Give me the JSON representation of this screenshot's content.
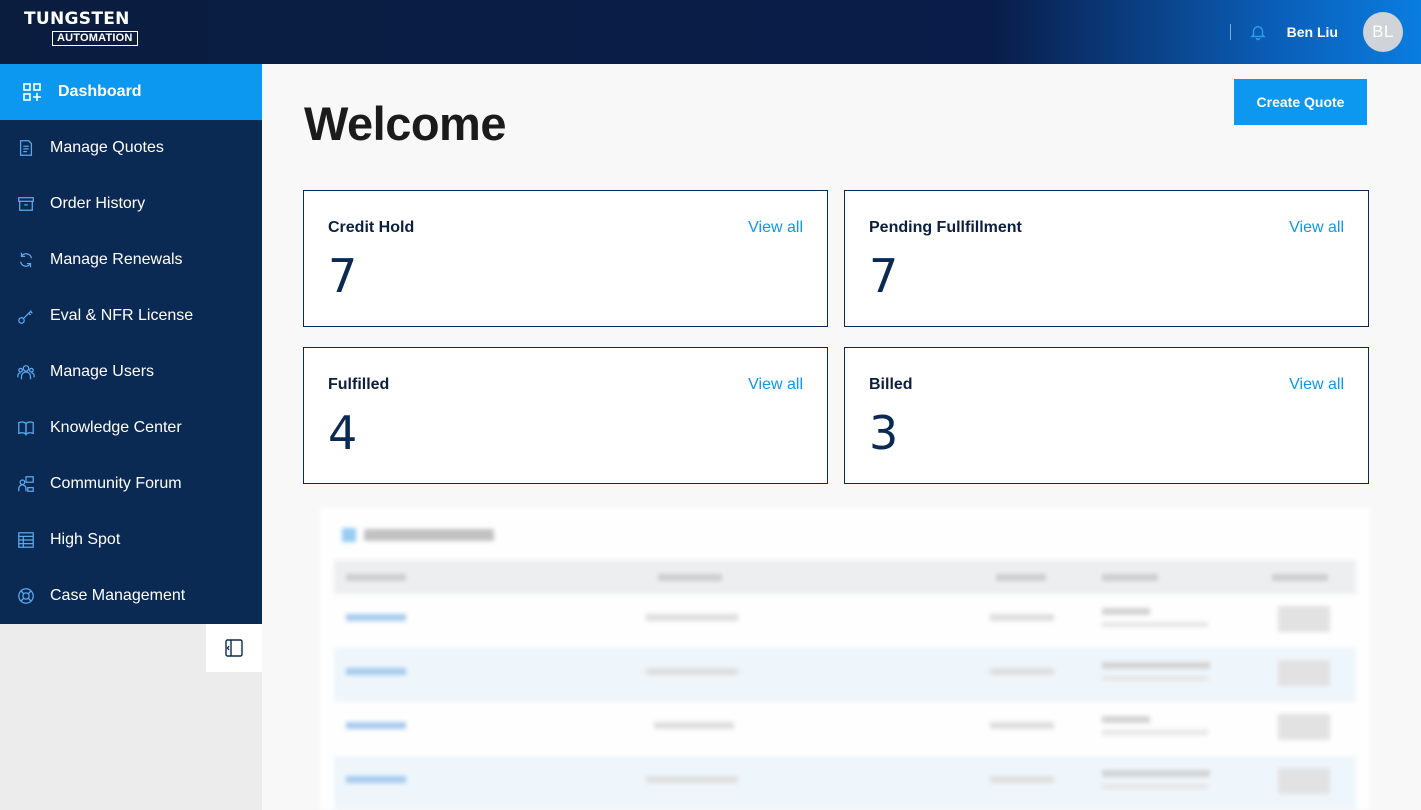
{
  "header": {
    "brand": {
      "line1": "TUNGSTEN",
      "line2": "AUTOMATION"
    },
    "user_name": "Ben Liu",
    "avatar_initials": "BL"
  },
  "sidebar": {
    "items": [
      {
        "label": "Dashboard",
        "icon": "dashboard-icon",
        "active": true
      },
      {
        "label": "Manage Quotes",
        "icon": "document-icon"
      },
      {
        "label": "Order History",
        "icon": "archive-icon"
      },
      {
        "label": "Manage Renewals",
        "icon": "refresh-icon"
      },
      {
        "label": "Eval & NFR License",
        "icon": "key-icon"
      },
      {
        "label": "Manage Users",
        "icon": "users-icon"
      },
      {
        "label": "Knowledge Center",
        "icon": "book-icon"
      },
      {
        "label": "Community Forum",
        "icon": "community-icon"
      },
      {
        "label": "High Spot",
        "icon": "spreadsheet-icon"
      },
      {
        "label": "Case Management",
        "icon": "lifebuoy-icon"
      }
    ]
  },
  "main": {
    "title": "Welcome",
    "create_quote_label": "Create Quote",
    "cards": [
      {
        "title": "Credit Hold",
        "value": "7",
        "link": "View all"
      },
      {
        "title": "Pending Fullfillment",
        "value": "7",
        "link": "View all"
      },
      {
        "title": "Fulfilled",
        "value": "4",
        "link": "View all"
      },
      {
        "title": "Billed",
        "value": "3",
        "link": "View all"
      }
    ]
  },
  "colors": {
    "sidebar_bg": "#0a2a54",
    "accent": "#0c98f0",
    "header_dark": "#0a1d3f"
  }
}
